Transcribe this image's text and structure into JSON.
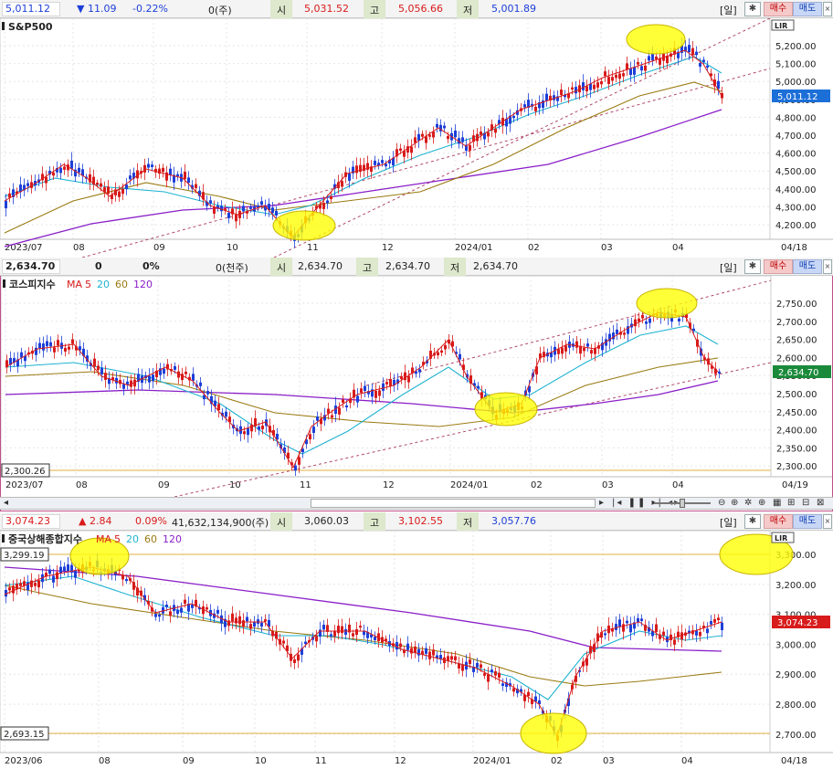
{
  "colors": {
    "up": "#d81b1b",
    "down": "#1d3fd8",
    "ma5": "#d81b1b",
    "ma20": "#1fb3d1",
    "ma60": "#9a7b12",
    "ma120": "#8a1fc8",
    "grid": "#e6e6e6",
    "highlight": "#ffff00",
    "trend": "#b04a6a",
    "level": "#e0b040"
  },
  "icons": [
    "gear-icon",
    "close-icon",
    "scroll-left-icon",
    "scroll-right-icon",
    "zoom-out-icon",
    "zoom-in-icon",
    "settings-icon",
    "filter-icon",
    "calendar-icon",
    "fit-icon"
  ],
  "panels": [
    {
      "key": "sp500",
      "header": {
        "price": "5,011.12",
        "arrow": "▼",
        "change": "11.09",
        "pct": "-0.22%",
        "volume": "0(주)",
        "open_label": "시",
        "open": "5,031.52",
        "high_label": "고",
        "high": "5,056.66",
        "low_label": "저",
        "low": "5,001.89",
        "period": "[일]",
        "buy": "매수",
        "sell": "매도"
      },
      "title": "S&P500",
      "legend": [],
      "lir": "LIR",
      "y_ticks": [
        "5,200.00",
        "5,100.00",
        "5,000.00",
        "4,900.00",
        "4,800.00",
        "4,700.00",
        "4,600.00",
        "4,500.00",
        "4,400.00",
        "4,300.00",
        "4,200.00"
      ],
      "x_ticks": [
        "2023/07",
        "08",
        "09",
        "10",
        "11",
        "12",
        "2024/01",
        "02",
        "03",
        "04"
      ],
      "date_label": "04/18",
      "last_label": "5,011.12",
      "level_label": ""
    },
    {
      "key": "kospi",
      "header": {
        "price": "2,634.70",
        "arrow": "",
        "change": "0",
        "pct": "0%",
        "volume": "0(천주)",
        "open_label": "시",
        "open": "2,634.70",
        "high_label": "고",
        "high": "2,634.70",
        "low_label": "저",
        "low": "2,634.70",
        "period": "[일]",
        "buy": "매수",
        "sell": "매도"
      },
      "title": "코스피지수",
      "legend": [
        "MA",
        "5",
        "20",
        "60",
        "120"
      ],
      "lir": "",
      "y_ticks": [
        "2,750.00",
        "2,700.00",
        "2,650.00",
        "2,600.00",
        "2,550.00",
        "2,500.00",
        "2,450.00",
        "2,400.00",
        "2,350.00",
        "2,300.00"
      ],
      "x_ticks": [
        "2023/07",
        "08",
        "09",
        "10",
        "11",
        "12",
        "2024/01",
        "02",
        "03",
        "04"
      ],
      "date_label": "04/19",
      "last_label": "2,634.70",
      "level_label": "2,300.26"
    },
    {
      "key": "shanghai",
      "header": {
        "price": "3,074.23",
        "arrow": "▲",
        "change": "2.84",
        "pct": "0.09%",
        "volume": "41,632,134,900(주)",
        "open_label": "시",
        "open": "3,060.03",
        "high_label": "고",
        "high": "3,102.55",
        "low_label": "저",
        "low": "3,057.76",
        "period": "[일]",
        "buy": "매수",
        "sell": "매도"
      },
      "title": "중국상해종합지수",
      "legend": [
        "MA",
        "5",
        "20",
        "60",
        "120"
      ],
      "lir": "LIR",
      "y_ticks": [
        "3,300.00",
        "3,200.00",
        "3,100.00",
        "3,000.00",
        "2,900.00",
        "2,800.00",
        "2,700.00"
      ],
      "x_ticks": [
        "2023/06",
        "08",
        "09",
        "10",
        "11",
        "12",
        "2024/01",
        "02",
        "03",
        "04"
      ],
      "date_label": "04/18",
      "last_label": "3,074.23",
      "level_label": "3,299.19",
      "level_label2": "2,693.15"
    }
  ]
}
